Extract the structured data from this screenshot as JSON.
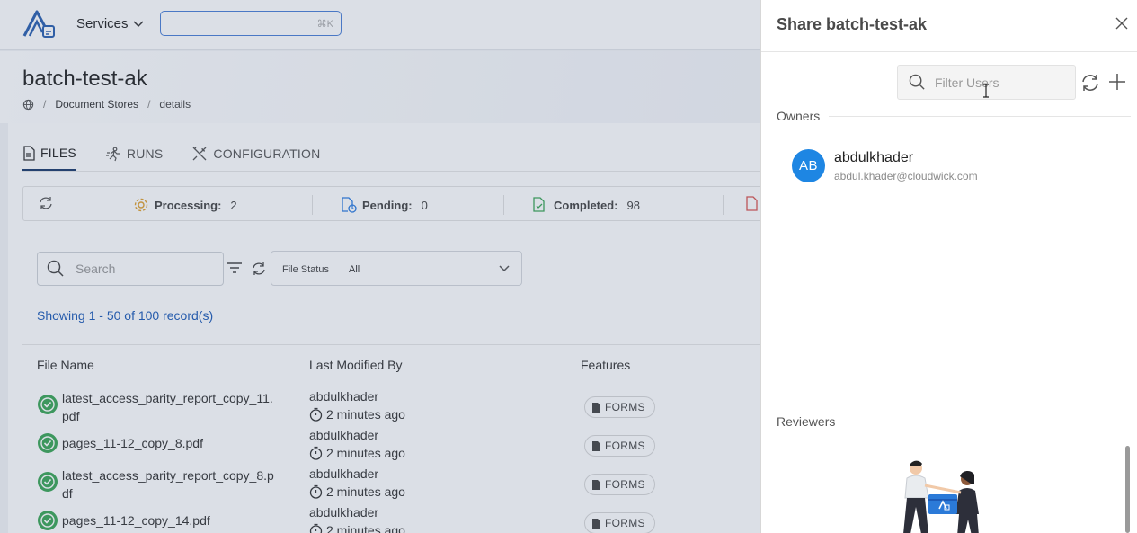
{
  "topbar": {
    "services_label": "Services",
    "search_shortcut": "⌘K"
  },
  "page": {
    "title": "batch-test-ak"
  },
  "breadcrumb": {
    "items": [
      "Document Stores",
      "details"
    ]
  },
  "tabs": [
    {
      "label": "FILES",
      "icon": "file-icon",
      "active": true
    },
    {
      "label": "RUNS",
      "icon": "runner-icon",
      "active": false
    },
    {
      "label": "CONFIGURATION",
      "icon": "tools-icon",
      "active": false
    }
  ],
  "stats": [
    {
      "label": "Processing:",
      "value": "2",
      "color": "#e0a030"
    },
    {
      "label": "Pending:",
      "value": "0",
      "color": "#2a7be0"
    },
    {
      "label": "Completed:",
      "value": "98",
      "color": "#3aa655"
    }
  ],
  "files": {
    "search_placeholder": "Search",
    "status_filter": {
      "label": "File Status",
      "value": "All"
    },
    "showing": "Showing 1 - 50 of 100 record(s)",
    "columns": [
      "File Name",
      "Last Modified By",
      "Features"
    ],
    "rows": [
      {
        "name": "latest_access_parity_report_copy_11.pdf",
        "user": "abdulkhader",
        "time": "2 minutes ago",
        "feature": "FORMS"
      },
      {
        "name": "pages_11-12_copy_8.pdf",
        "user": "abdulkhader",
        "time": "2 minutes ago",
        "feature": "FORMS"
      },
      {
        "name": "latest_access_parity_report_copy_8.pdf",
        "user": "abdulkhader",
        "time": "2 minutes ago",
        "feature": "FORMS"
      },
      {
        "name": "pages_11-12_copy_14.pdf",
        "user": "abdulkhader",
        "time": "2 minutes ago",
        "feature": "FORMS"
      }
    ]
  },
  "share": {
    "title": "Share batch-test-ak",
    "filter_placeholder": "Filter Users",
    "owners_label": "Owners",
    "owner": {
      "initials": "AB",
      "name": "abdulkhader",
      "email": "abdul.khader@cloudwick.com",
      "avatar_color": "#1e86e3"
    },
    "reviewers_label": "Reviewers"
  }
}
